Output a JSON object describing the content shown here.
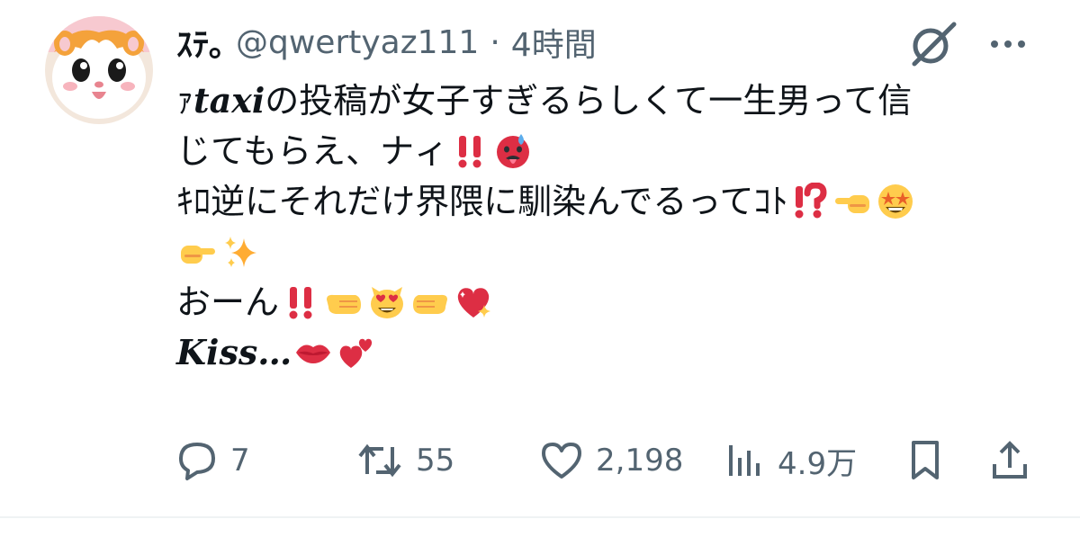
{
  "tweet": {
    "author": {
      "display_name": "ｽﾃ｡",
      "handle": "@qwertyaz111",
      "separator": "·",
      "time": "4時間",
      "avatar_icon": "hamster-avatar"
    },
    "header_icons": [
      "grok-icon",
      "more-icon"
    ],
    "text_lines": [
      [
        "ｧ",
        "𝒕𝒂𝒙𝒊",
        "の投稿が女子すぎるらしくて一生男って信"
      ],
      [
        "じてもらえ、ナィ"
      ],
      [
        "ｷﾛ逆にそれだけ界隈に馴染んでるってｺﾄ"
      ],
      [
        "おーん"
      ],
      [
        "𝑲𝒊𝒔𝒔…"
      ]
    ],
    "emojis": {
      "line2": [
        "double-exclamation-icon",
        "hot-face-icon"
      ],
      "line3": [
        "exclamation-question-icon",
        "pointing-left-icon",
        "star-struck-icon"
      ],
      "line4": [
        "pointing-right-icon",
        "sparkles-icon"
      ],
      "line5": [
        "double-exclamation-icon",
        "hand-left-icon",
        "heart-eyes-cat-icon",
        "hand-right-icon",
        "sparkling-heart-icon"
      ],
      "line6": [
        "kiss-mark-icon",
        "two-hearts-icon"
      ]
    },
    "actions": {
      "replies": "7",
      "retweets": "55",
      "likes": "2,198",
      "views": "4.9万"
    },
    "colors": {
      "text": "#0f1419",
      "secondary": "#536471",
      "divider": "#eff3f4",
      "emoji_red": "#dd2e44",
      "emoji_yellow": "#ffcc4d"
    }
  }
}
